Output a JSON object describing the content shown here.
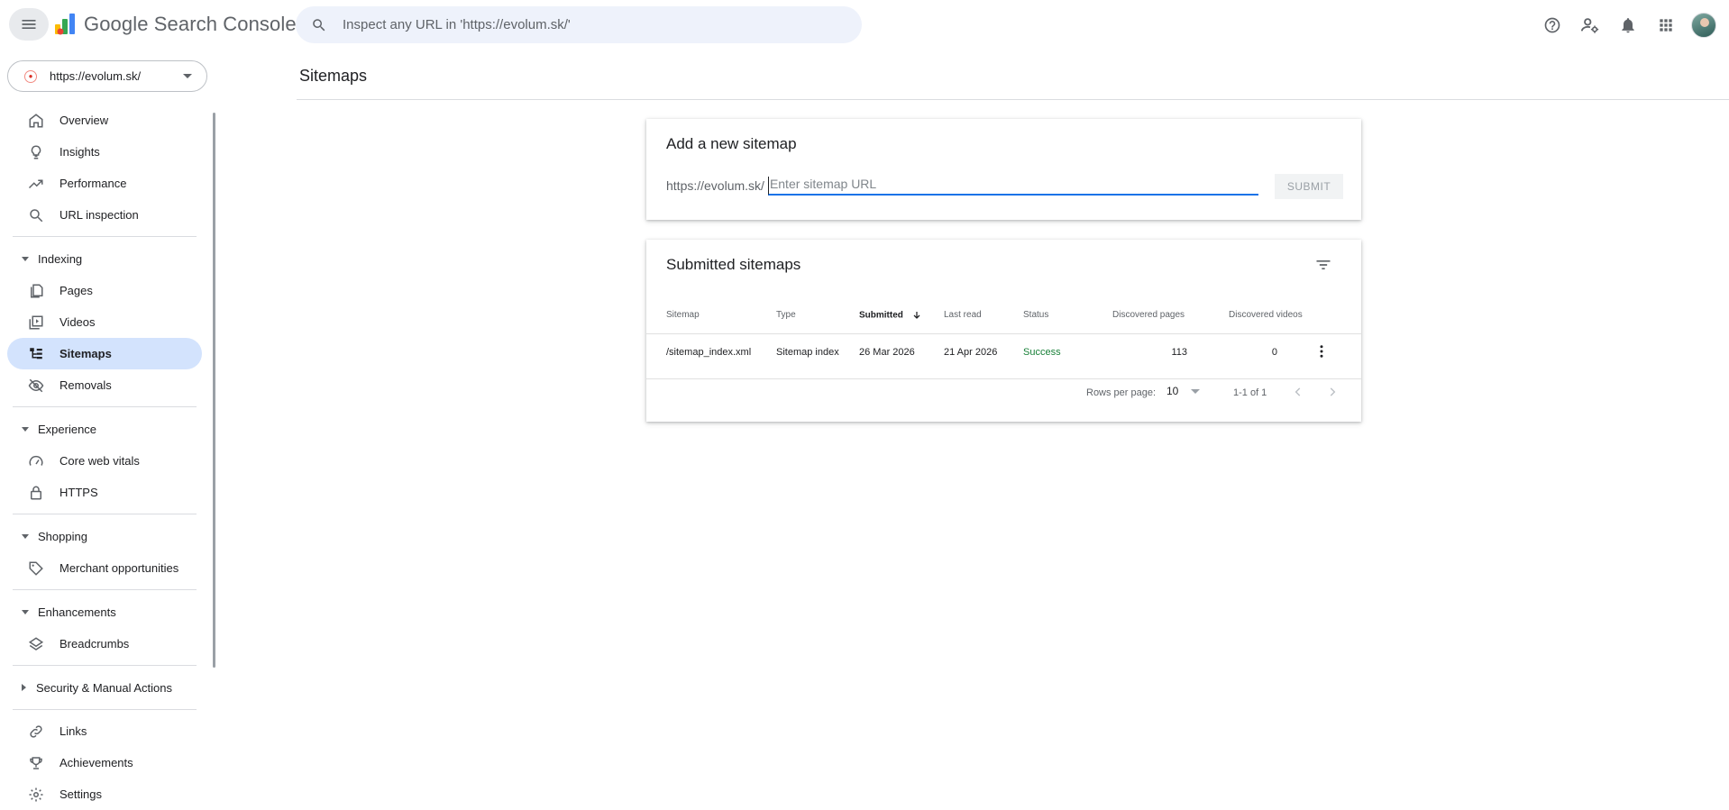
{
  "header": {
    "app_title": "Google Search Console",
    "search_placeholder": "Inspect any URL in 'https://evolum.sk/'",
    "icons": [
      "help-icon",
      "manage-accounts-icon",
      "notifications-icon",
      "apps-grid-icon",
      "account-avatar"
    ]
  },
  "property": {
    "url": "https://evolum.sk/"
  },
  "sidebar": {
    "top_items": [
      {
        "label": "Overview",
        "icon": "home-icon"
      },
      {
        "label": "Insights",
        "icon": "lightbulb-icon"
      },
      {
        "label": "Performance",
        "icon": "trending-up-icon"
      },
      {
        "label": "URL inspection",
        "icon": "search-icon"
      }
    ],
    "indexing": {
      "label": "Indexing",
      "items": [
        {
          "label": "Pages",
          "icon": "pages-icon"
        },
        {
          "label": "Videos",
          "icon": "video-library-icon"
        },
        {
          "label": "Sitemaps",
          "icon": "sitemap-icon",
          "active": true
        },
        {
          "label": "Removals",
          "icon": "visibility-off-icon"
        }
      ]
    },
    "experience": {
      "label": "Experience",
      "items": [
        {
          "label": "Core web vitals",
          "icon": "speed-icon"
        },
        {
          "label": "HTTPS",
          "icon": "lock-icon"
        }
      ]
    },
    "shopping": {
      "label": "Shopping",
      "items": [
        {
          "label": "Merchant opportunities",
          "icon": "tag-icon"
        }
      ]
    },
    "enhancements": {
      "label": "Enhancements",
      "items": [
        {
          "label": "Breadcrumbs",
          "icon": "layers-icon"
        }
      ]
    },
    "security": {
      "label": "Security & Manual Actions"
    },
    "bottom_items": [
      {
        "label": "Links",
        "icon": "link-icon"
      },
      {
        "label": "Achievements",
        "icon": "trophy-icon"
      },
      {
        "label": "Settings",
        "icon": "gear-icon"
      }
    ]
  },
  "main": {
    "page_title": "Sitemaps",
    "add_card": {
      "title": "Add a new sitemap",
      "prefix": "https://evolum.sk/",
      "input_placeholder": "Enter sitemap URL",
      "submit_label": "SUBMIT"
    },
    "submitted_card": {
      "title": "Submitted sitemaps",
      "columns": [
        "Sitemap",
        "Type",
        "Submitted",
        "Last read",
        "Status",
        "Discovered pages",
        "Discovered videos"
      ],
      "sorted_column": "Submitted",
      "rows": [
        {
          "sitemap": "/sitemap_index.xml",
          "type": "Sitemap index",
          "submitted": "26 Mar 2026",
          "last_read": "21 Apr 2026",
          "status": "Success",
          "pages": "113",
          "videos": "0"
        }
      ],
      "pagination": {
        "rows_per_page_label": "Rows per page:",
        "rows_per_page": "10",
        "range": "1-1 of 1"
      }
    },
    "colors": {
      "accent": "#1a73e8",
      "active_nav": "#d3e3fd",
      "success": "#188038"
    }
  }
}
